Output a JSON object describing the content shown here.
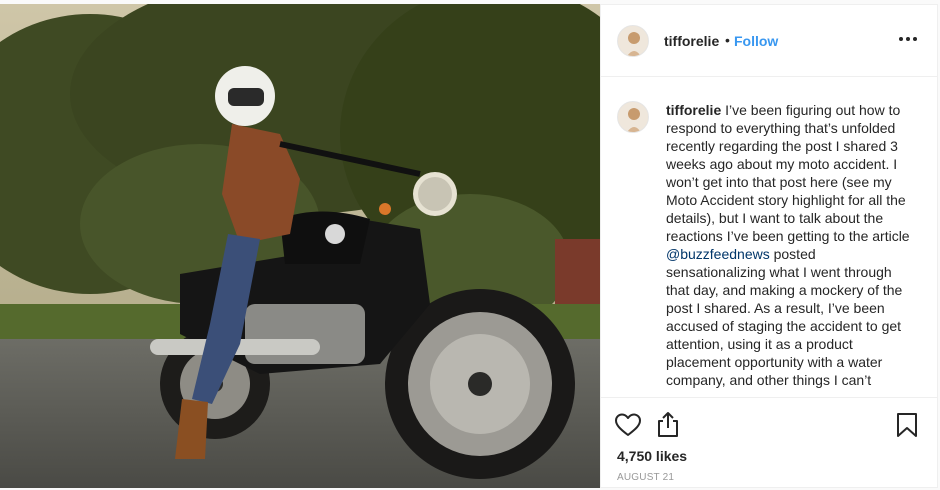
{
  "post": {
    "username": "tifforelie",
    "separator": "•",
    "follow_label": "Follow",
    "more_icon": "more-options-icon"
  },
  "caption": {
    "username": "tifforelie",
    "text_part1": "I’ve been figuring out how to respond to everything that’s unfolded recently regarding the post I shared 3 weeks ago about my moto accident. I won’t get into that post here (see my Moto Accident story highlight for all the details), but I want to talk about the reactions I’ve been getting to the article ",
    "mention": "@buzzfeednews",
    "text_part2": " posted sensationalizing what I went through that day, and making a mockery of the post I shared. As a result, I’ve been accused of staging the accident to get attention, using it as a product placement opportunity with a water company, and other things I can’t"
  },
  "actions": {
    "like_icon": "heart-icon",
    "share_icon": "share-icon",
    "save_icon": "bookmark-icon"
  },
  "likes": {
    "count_text": "4,750 likes"
  },
  "date": {
    "text": "AUGUST 21"
  },
  "colors": {
    "link": "#3897f0",
    "mention": "#003569",
    "text": "#262626",
    "muted": "#999999",
    "border": "#efefef"
  }
}
